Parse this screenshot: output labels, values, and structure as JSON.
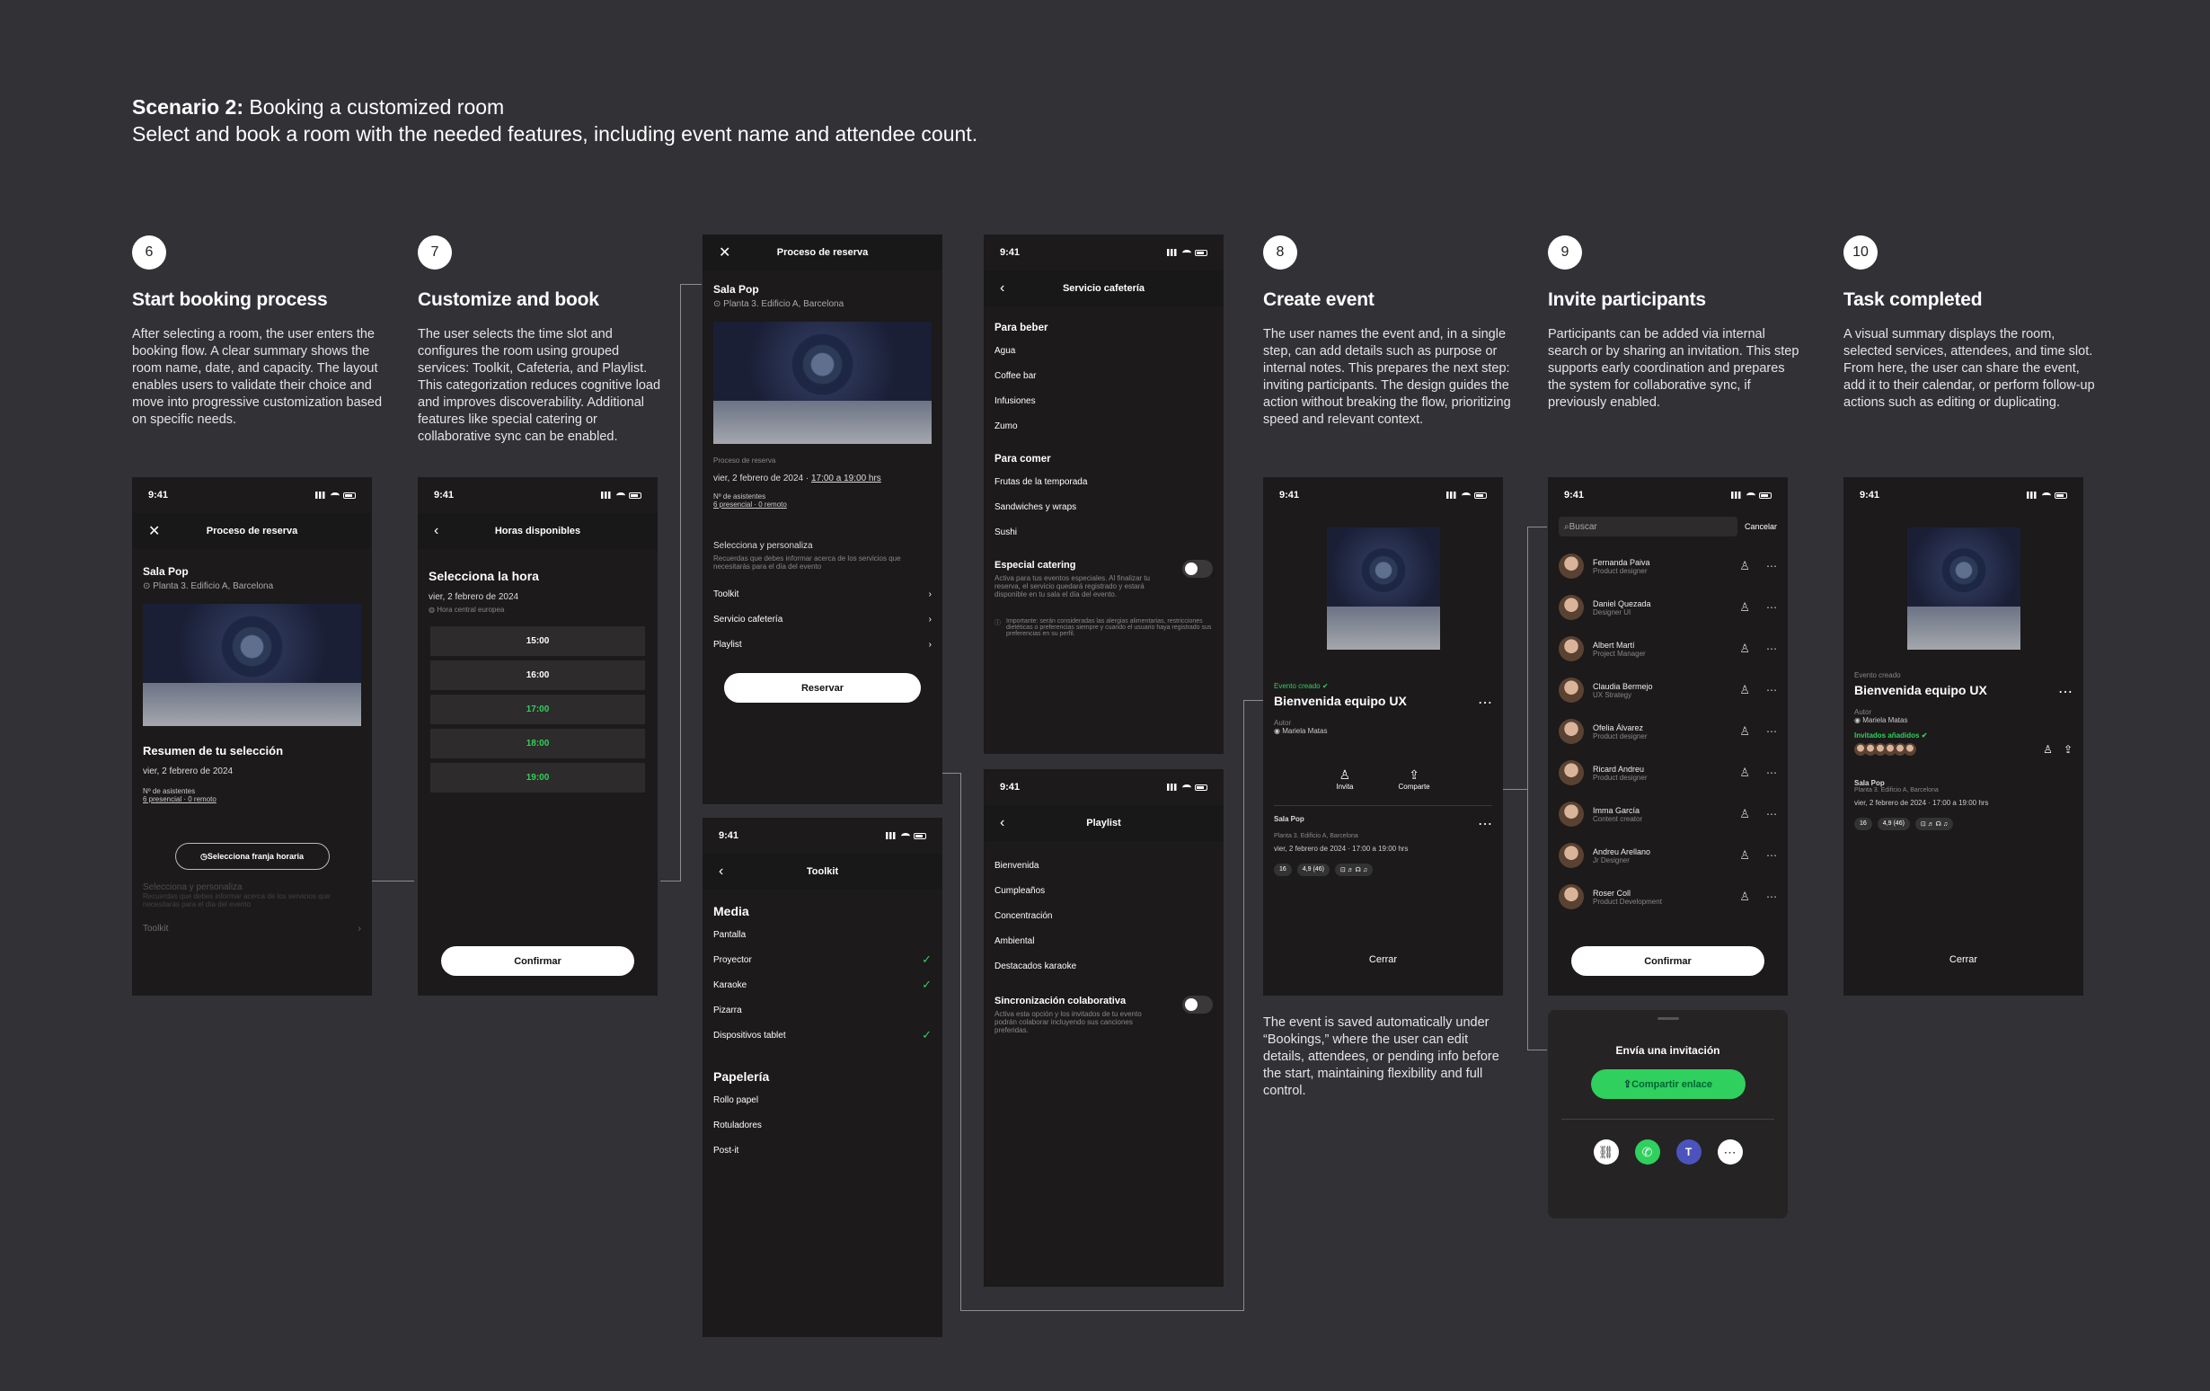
{
  "header": {
    "title_bold": "Scenario 2:",
    "title_rest": " Booking a customized room",
    "subtitle": "Select and book a room with the needed features, including event name and attendee count."
  },
  "steps": [
    {
      "num": "6",
      "title": "Start booking process",
      "desc": "After selecting a room, the user enters the booking flow. A clear summary shows the room name, date, and capacity. The layout enables users to validate their choice and move into progressive customization based on specific needs."
    },
    {
      "num": "7",
      "title": "Customize and book",
      "desc": "The user selects the time slot and configures the room using grouped services: Toolkit, Cafeteria, and Playlist. This categorization reduces cognitive load and improves discoverability. Additional features like special catering or collaborative sync can be enabled."
    },
    {
      "num": "8",
      "title": "Create event",
      "desc": " The user names the event and, in a single step, can add details such as purpose or internal notes. This prepares the next step: inviting participants. The design guides the action without breaking the flow, prioritizing speed and relevant context."
    },
    {
      "num": "9",
      "title": "Invite participants",
      "desc": "Participants can be added via internal search or by sharing an invitation. This step supports early coordination and prepares the system for collaborative sync, if previously enabled."
    },
    {
      "num": "10",
      "title": "Task completed",
      "desc": "A visual summary displays the room, selected services, attendees, and time slot. From here, the user can share the event, add it to their calendar, or perform follow-up actions such as editing or duplicating."
    }
  ],
  "event_note": "The event is saved automatically under “Bookings,” where the user can edit details, attendees, or pending info before the start, maintaining flexibility and full control.",
  "status_time": "9:41",
  "s1": {
    "nav": "Proceso de reserva",
    "room": "Sala Pop",
    "loc": "Planta 3. Edificio A, Barcelona",
    "summary": "Resumen de tu selección",
    "date": "vier, 2 febrero de 2024",
    "att_label": "Nº de asistentes",
    "att_value": "6 presencial · 0 remoto",
    "slot_btn": "Selecciona franja horaria",
    "custom": "Selecciona y personaliza",
    "custom_desc": "Recuerdas que debes informar acerca de los servicios que necesitarás para el día del evento",
    "toolkit": "Toolkit"
  },
  "s2": {
    "nav": "Horas disponibles",
    "title": "Selecciona la hora",
    "date": "vier, 2 febrero de 2024",
    "tz": "Hora central europea",
    "slots": [
      "15:00",
      "16:00",
      "17:00",
      "18:00",
      "19:00"
    ],
    "confirm": "Confirmar"
  },
  "s3": {
    "nav": "Proceso de reserva",
    "room": "Sala Pop",
    "loc": "Planta 3. Edificio A, Barcelona",
    "proc": "Proceso de reserva",
    "date": "vier, 2 febrero de 2024",
    "time": "17:00 a 19:00 hrs",
    "att_label": "Nº de asistentes",
    "att_value": "6 presencial · 0 remoto",
    "custom": "Selecciona y personaliza",
    "custom_desc": "Recuerdas que debes informar acerca de los servicios que necesitarás para el día del evento",
    "items": [
      "Toolkit",
      "Servicio cafetería",
      "Playlist"
    ],
    "reserve": "Reservar"
  },
  "s4": {
    "nav": "Toolkit",
    "media": "Media",
    "media_items": [
      {
        "l": "Pantalla",
        "c": false
      },
      {
        "l": "Proyector",
        "c": true
      },
      {
        "l": "Karaoke",
        "c": true
      },
      {
        "l": "Pizarra",
        "c": false
      },
      {
        "l": "Dispositivos tablet",
        "c": true
      }
    ],
    "paper": "Papelería",
    "paper_items": [
      "Rollo papel",
      "Rotuladores",
      "Post-it"
    ]
  },
  "s5": {
    "nav": "Servicio cafetería",
    "drink": "Para beber",
    "drink_items": [
      "Agua",
      "Coffee bar",
      "Infusiones",
      "Zumo"
    ],
    "food": "Para comer",
    "food_items": [
      "Frutas de la temporada",
      "Sandwiches y wraps",
      "Sushi"
    ],
    "cat": "Especial catering",
    "cat_desc": "Activa para tus eventos especiales. Al finalizar tu reserva, el servicio quedará registrado y estará disponible en tu sala el día del evento.",
    "important": "Importante: serán consideradas las alergias alimentarias, restricciones dietéticas o preferencias siempre y cuando el usuario haya registrado sus preferencias en su perfil."
  },
  "s6": {
    "nav": "Playlist",
    "items": [
      "Bienvenida",
      "Cumpleaños",
      "Concentración",
      "Ambiental",
      "Destacados karaoke"
    ],
    "sync": "Sincronización colaborativa",
    "sync_desc": "Activa esta opción y los invitados de tu evento podrán colaborar incluyendo sus canciones preferidas."
  },
  "s7": {
    "created": "Evento creado",
    "title": "Bienvenida equipo UX",
    "author_l": "Autor",
    "author": "Mariela Matas",
    "invite": "Invita",
    "share": "Comparte",
    "room": "Sala Pop",
    "loc": "Planta 3. Edificio A, Barcelona",
    "date": "vier, 2 febrero de 2024 · 17:00 a 19:00 hrs",
    "tags": [
      "16",
      "4,9 (46)",
      "⊡ ♬ ☊ ♫"
    ],
    "close": "Cerrar"
  },
  "s8": {
    "search": "Buscar",
    "cancel": "Cancelar",
    "people": [
      {
        "n": "Fernanda Paiva",
        "r": "Product designer"
      },
      {
        "n": "Daniel Quezada",
        "r": "Designer UI"
      },
      {
        "n": "Albert Martí",
        "r": "Project Manager"
      },
      {
        "n": "Claudia Bermejo",
        "r": "UX Strategy"
      },
      {
        "n": "Ofelia Álvarez",
        "r": "Product designer"
      },
      {
        "n": "Ricard Andreu",
        "r": "Product designer"
      },
      {
        "n": "Imma García",
        "r": "Content creator"
      },
      {
        "n": "Andreu Arellano",
        "r": "Jr Designer"
      },
      {
        "n": "Roser Coll",
        "r": "Product Development"
      }
    ],
    "confirm": "Confirmar"
  },
  "s9": {
    "title": "Envía una invitación",
    "share": "Compartir enlace"
  },
  "s10": {
    "created": "Evento creado",
    "title": "Bienvenida equipo UX",
    "author_l": "Autor",
    "author": "Mariela Matas",
    "invited": "Invitados añadidos",
    "room": "Sala Pop",
    "loc": "Planta 3. Edificio A, Barcelona",
    "date": "vier, 2 febrero de 2024 · 17:00 a 19:00 hrs",
    "tags": [
      "16",
      "4,9 (46)",
      "⊡ ♬ ☊ ♫"
    ],
    "close": "Cerrar"
  },
  "colors": {
    "bg": "#323136",
    "phone": "#1c1a1a",
    "accent": "#2fd05d"
  }
}
